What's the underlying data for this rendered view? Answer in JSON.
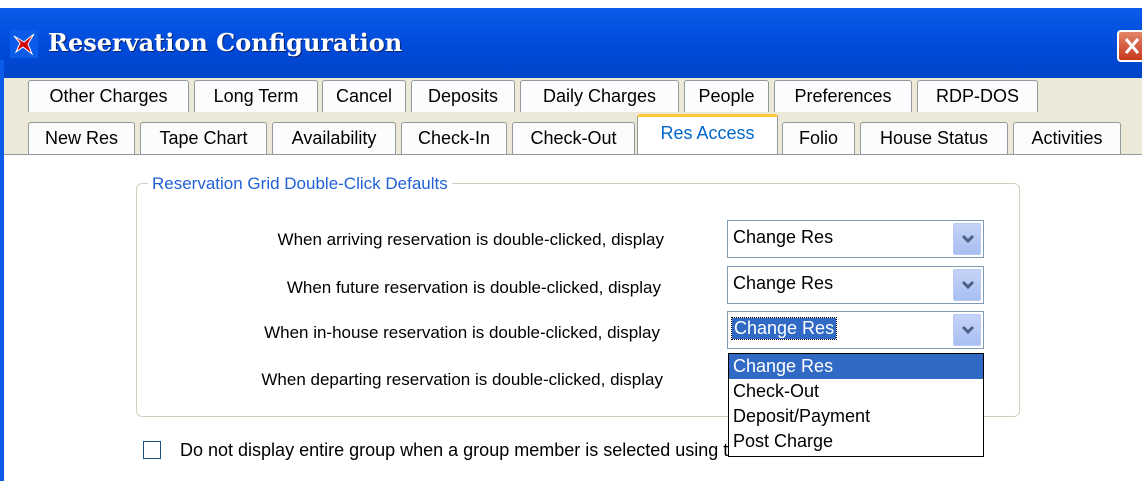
{
  "window": {
    "title": "Reservation Configuration",
    "app_icon": "bird-logo-icon",
    "close_icon": "close-icon"
  },
  "tabs": {
    "row1": [
      "Other Charges",
      "Long Term",
      "Cancel",
      "Deposits",
      "Daily Charges",
      "People",
      "Preferences",
      "RDP-DOS"
    ],
    "row2": [
      "New Res",
      "Tape Chart",
      "Availability",
      "Check-In",
      "Check-Out",
      "Res Access",
      "Folio",
      "House Status",
      "Activities"
    ],
    "active": "Res Access"
  },
  "group": {
    "title": "Reservation Grid Double-Click Defaults",
    "rows": [
      {
        "label": "When arriving reservation is double-clicked, display",
        "value": "Change Res"
      },
      {
        "label": "When future reservation is double-clicked, display",
        "value": "Change Res"
      },
      {
        "label": "When in-house reservation is double-clicked, display",
        "value": "Change Res"
      },
      {
        "label": "When departing reservation is double-clicked, display",
        "value": ""
      }
    ]
  },
  "dropdown": {
    "options": [
      "Change Res",
      "Check-Out",
      "Deposit/Payment",
      "Post Charge"
    ],
    "highlighted": "Change Res"
  },
  "checkbox": {
    "label": "Do not display entire group when a group member is selected using the \"Find Res\"",
    "checked": false
  },
  "colors": {
    "title_bar": "#0a5ce8",
    "accent_tab": "#ffc83c",
    "selection": "#316ac5",
    "group_title": "#2161d5"
  }
}
